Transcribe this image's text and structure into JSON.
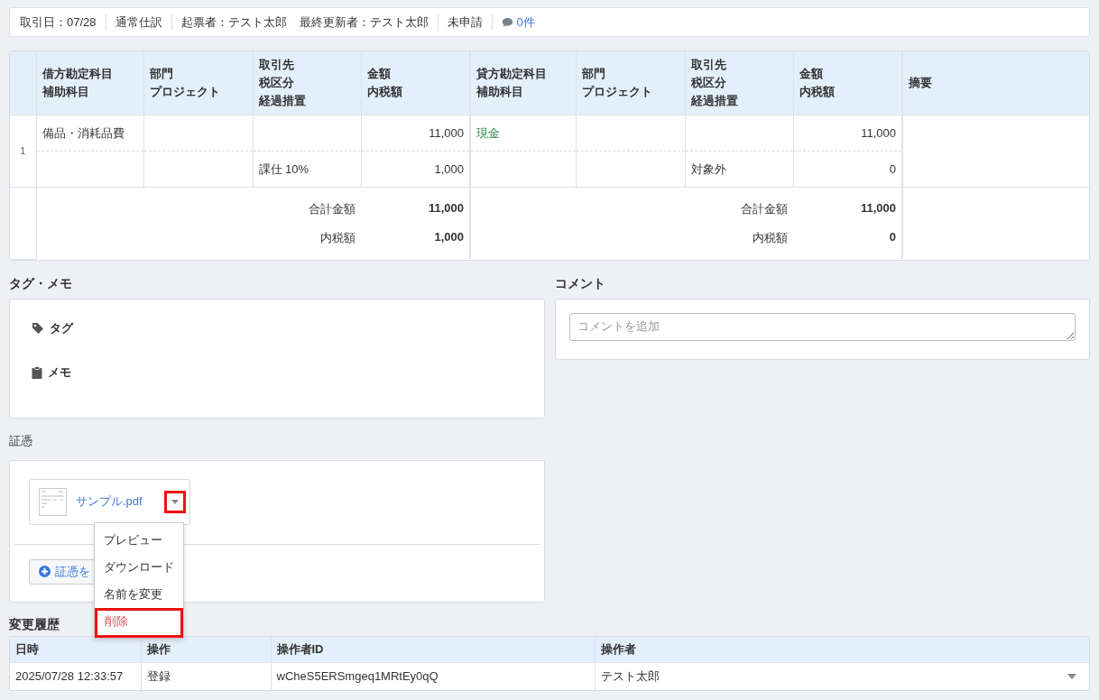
{
  "info_bar": {
    "groups": [
      [
        "取引日：07/28"
      ],
      [
        "通常仕訳"
      ],
      [
        "起票者：テスト太郎",
        "最終更新者：テスト太郎"
      ],
      [
        "未申請"
      ]
    ],
    "comment_count": "0件"
  },
  "journal": {
    "debit_headers": [
      [
        "借方勘定科目",
        "補助科目"
      ],
      [
        "部門",
        "プロジェクト"
      ],
      [
        "取引先",
        "税区分",
        "経過措置"
      ],
      [
        "金額",
        "内税額"
      ]
    ],
    "credit_headers": [
      [
        "貸方勘定科目",
        "補助科目"
      ],
      [
        "部門",
        "プロジェクト"
      ],
      [
        "取引先",
        "税区分",
        "経過措置"
      ],
      [
        "金額",
        "内税額"
      ]
    ],
    "summary_header": "摘要",
    "rows": [
      {
        "number": "1",
        "debit": {
          "account": "備品・消耗品費",
          "tax_category": "課仕 10%",
          "amount": "11,000",
          "tax_amount": "1,000"
        },
        "credit": {
          "account": "現金",
          "tax_category": "対象外",
          "amount": "11,000",
          "tax_amount": "0"
        }
      }
    ],
    "totals": {
      "debit": {
        "total_label": "合計金額",
        "total": "11,000",
        "tax_label": "内税額",
        "tax": "1,000"
      },
      "credit": {
        "total_label": "合計金額",
        "total": "11,000",
        "tax_label": "内税額",
        "tax": "0"
      }
    }
  },
  "tag_memo": {
    "title": "タグ・メモ",
    "tag_label": "タグ",
    "memo_label": "メモ"
  },
  "comment": {
    "title": "コメント",
    "placeholder": "コメントを追加"
  },
  "evidence": {
    "title": "証憑",
    "file_name": "サンプル.pdf",
    "toggle_highlighted": true,
    "add_button": "証憑を",
    "menu": [
      {
        "label": "プレビュー",
        "kind": "normal",
        "highlighted": false
      },
      {
        "label": "ダウンロード",
        "kind": "normal",
        "highlighted": false
      },
      {
        "label": "名前を変更",
        "kind": "normal",
        "highlighted": false
      },
      {
        "label": "削除",
        "kind": "danger",
        "highlighted": true
      }
    ]
  },
  "history": {
    "title": "変更履歴",
    "columns": [
      "日時",
      "操作",
      "操作者ID",
      "操作者"
    ],
    "rows": [
      [
        "2025/07/28 12:33:57",
        "登録",
        "wCheS5ERSmgeq1MRtEy0qQ",
        "テスト太郎"
      ]
    ]
  }
}
